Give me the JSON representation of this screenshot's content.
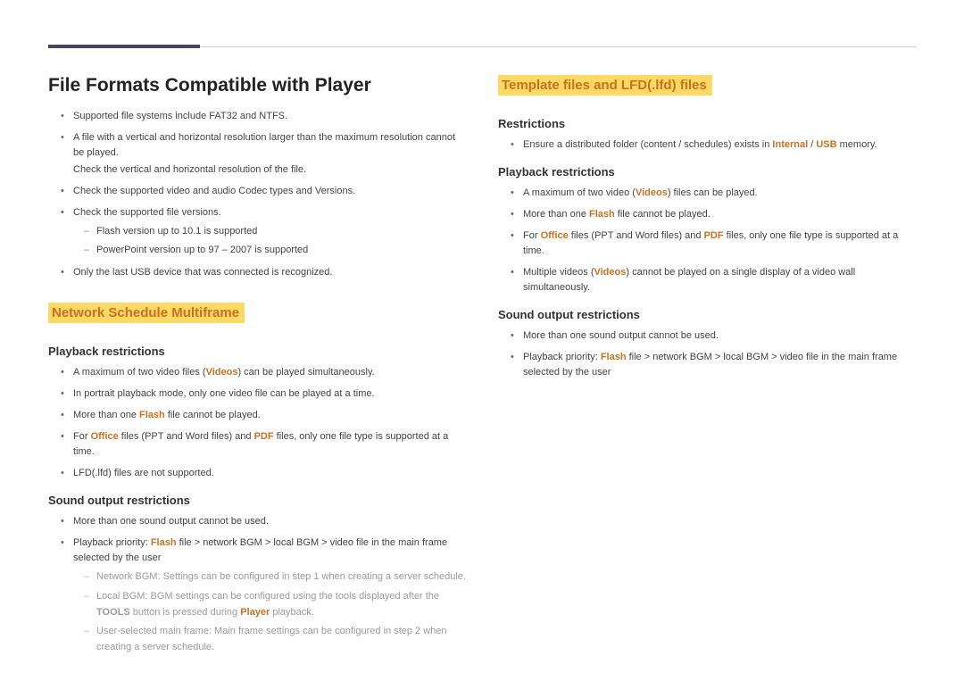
{
  "left": {
    "h1": "File Formats Compatible with Player",
    "top_bullets": {
      "i0": "Supported file systems include FAT32 and NTFS.",
      "i1": "A file with a vertical and horizontal resolution larger than the maximum resolution cannot be played.",
      "i1sub": "Check the vertical and horizontal resolution of the file.",
      "i2": "Check the supported video and audio Codec types and Versions.",
      "i3": "Check the supported file versions.",
      "i3_dash0": "Flash version up to 10.1 is supported",
      "i3_dash1": "PowerPoint version up to 97 – 2007 is supported",
      "i4": "Only the last USB device that was connected is recognized."
    },
    "section1": {
      "title": "Network Schedule Multiframe",
      "sub1": {
        "title": "Playback restrictions",
        "b0_a": "A maximum of two video files (",
        "b0_b": "Videos",
        "b0_c": ") can be played simultaneously.",
        "b1": "In portrait playback mode, only one video file can be played at a time.",
        "b2_a": "More than one ",
        "b2_b": "Flash",
        "b2_c": " file cannot be played.",
        "b3_a": "For ",
        "b3_b": "Office",
        "b3_c": " files (PPT and Word files) and ",
        "b3_d": "PDF",
        "b3_e": " files, only one file type is supported at a time.",
        "b4": "LFD(.lfd) files are not supported."
      },
      "sub2": {
        "title": "Sound output restrictions",
        "b0": "More than one sound output cannot be used.",
        "b1_a": "Playback priority: ",
        "b1_b": "Flash",
        "b1_c": " file > network BGM > local BGM > video file in the main frame selected by the user",
        "b1_d0": "Network BGM: Settings can be configured in step 1 when creating a server schedule.",
        "b1_d1_a": "Local BGM: BGM settings can be configured using the tools displayed after the ",
        "b1_d1_b": "TOOLS",
        "b1_d1_c": " button is pressed during ",
        "b1_d1_d": "Player",
        "b1_d1_e": " playback.",
        "b1_d2": "User-selected main frame: Main frame settings can be configured in step 2 when creating a server schedule."
      }
    }
  },
  "right": {
    "section2": {
      "title": "Template files and LFD(.lfd) files",
      "sub1": {
        "title": "Restrictions",
        "b0_a": "Ensure a distributed folder (content / schedules) exists in ",
        "b0_b": "Internal",
        "b0_c": " / ",
        "b0_d": "USB",
        "b0_e": " memory."
      },
      "sub2": {
        "title": "Playback restrictions",
        "b0_a": "A maximum of two video (",
        "b0_b": "Videos",
        "b0_c": ") files can be played.",
        "b1_a": "More than one ",
        "b1_b": "Flash",
        "b1_c": " file cannot be played.",
        "b2_a": "For ",
        "b2_b": "Office",
        "b2_c": " files (PPT and Word files) and ",
        "b2_d": "PDF",
        "b2_e": " files, only one file type is supported at a time.",
        "b3_a": "Multiple videos (",
        "b3_b": "Videos",
        "b3_c": ") cannot be played on a single display of a video wall simultaneously."
      },
      "sub3": {
        "title": "Sound output restrictions",
        "b0": "More than one sound output cannot be used.",
        "b1_a": "Playback priority: ",
        "b1_b": "Flash",
        "b1_c": " file > network BGM > local BGM > video file in the main frame selected by the user"
      }
    }
  }
}
